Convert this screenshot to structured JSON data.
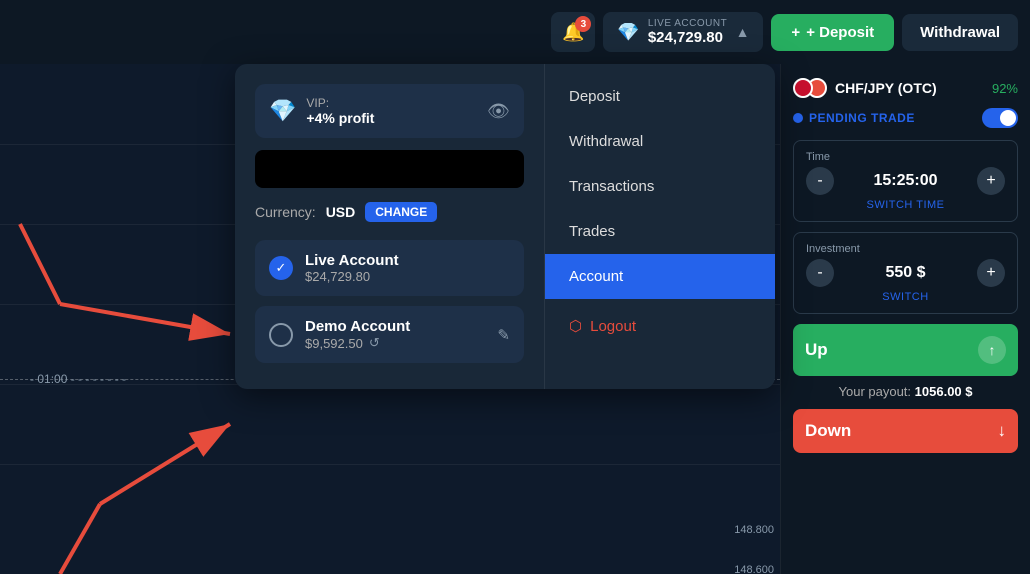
{
  "header": {
    "notif_count": "3",
    "account_label": "LIVE ACCOUNT",
    "account_value": "$24,729.80",
    "deposit_label": "+ Deposit",
    "withdrawal_label": "Withdrawal"
  },
  "dropdown": {
    "vip_label": "VIP:",
    "vip_profit": "+4% profit",
    "currency_label": "Currency:",
    "currency_value": "USD",
    "change_label": "CHANGE",
    "live_account_name": "Live Account",
    "live_account_balance": "$24,729.80",
    "demo_account_name": "Demo Account",
    "demo_account_balance": "$9,592.50",
    "menu_items": [
      "Deposit",
      "Withdrawal",
      "Transactions",
      "Trades",
      "Account"
    ],
    "logout_label": "Logout"
  },
  "right_panel": {
    "pair": "CHF/JPY (OTC)",
    "pair_pct": "92%",
    "pending_label": "PENDING TRADE",
    "time_label": "Time",
    "time_value": "15:25:00",
    "switch_time_label": "SWITCH TIME",
    "investment_label": "Investment",
    "investment_value": "550 $",
    "switch_label": "SWITCH",
    "up_label": "Up",
    "down_label": "Down",
    "payout_label": "Your payout:",
    "payout_value": "1056.00 $",
    "minus_label": "-",
    "plus_label": "+"
  },
  "chart": {
    "labels": [
      "148.800",
      "148.600"
    ],
    "dashed_label": "01:00"
  }
}
